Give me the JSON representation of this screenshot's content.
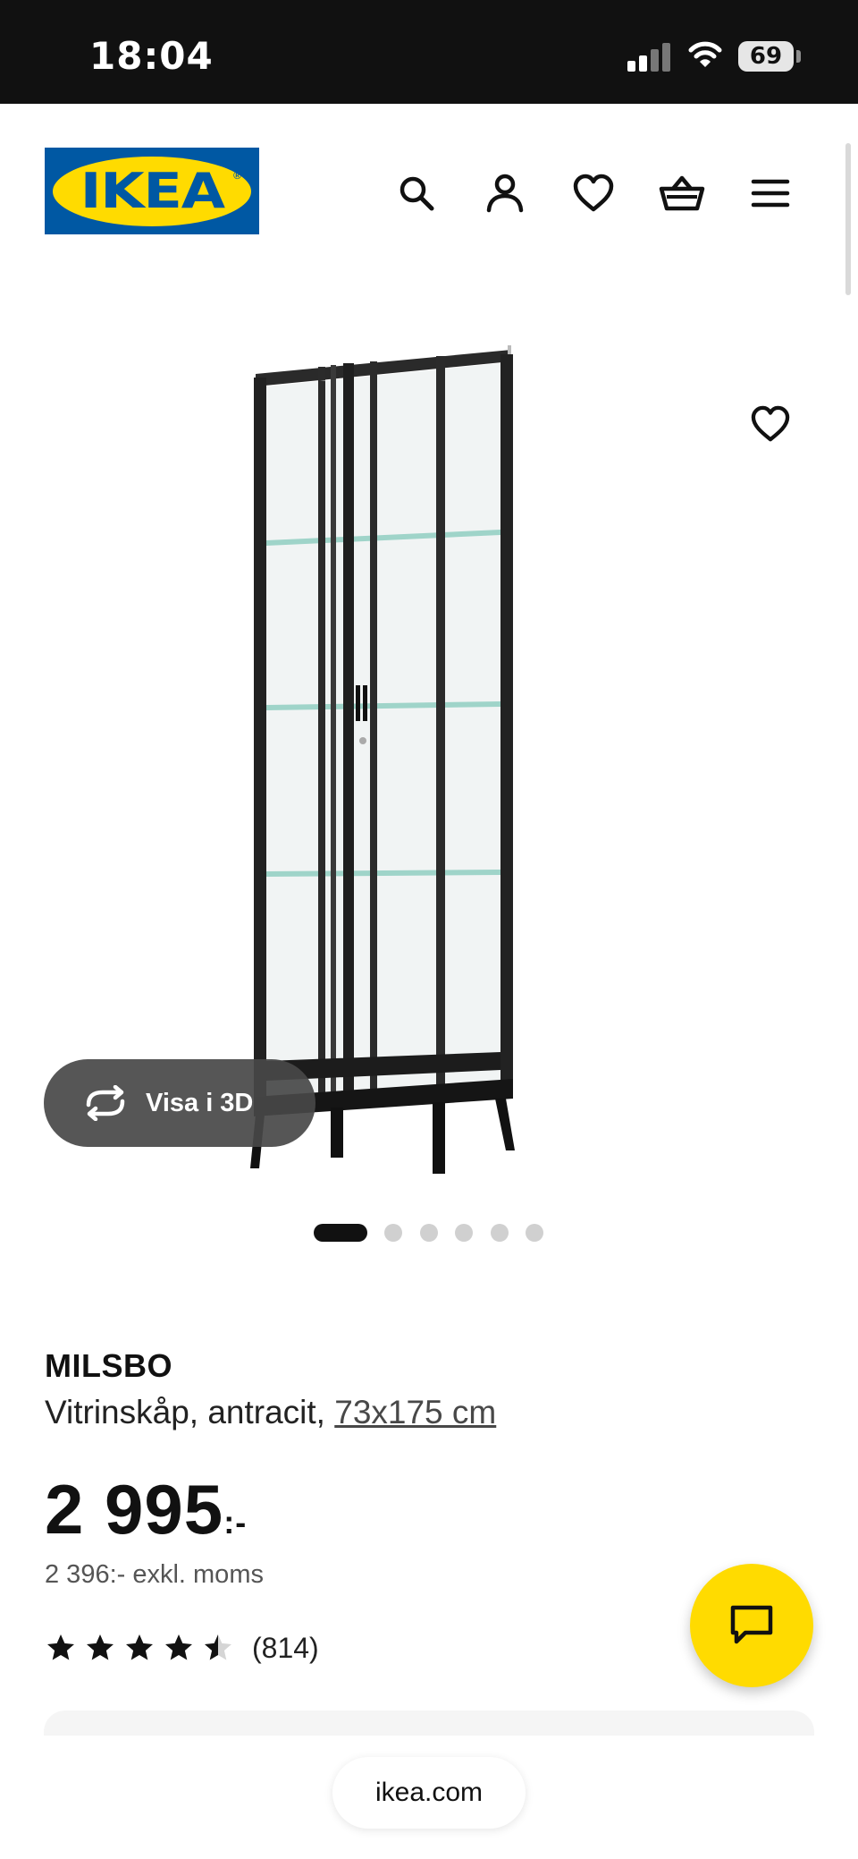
{
  "status_bar": {
    "time": "18:04",
    "battery_level": "69",
    "icons": [
      "signal-icon",
      "wifi-icon",
      "battery-icon"
    ]
  },
  "header": {
    "logo_text": "IKEA",
    "logo_registered": "®",
    "icons": [
      "search-icon",
      "account-icon",
      "favorites-icon",
      "cart-icon",
      "menu-icon"
    ],
    "brand_colors": {
      "blue": "#0058a3",
      "yellow": "#ffdb00"
    }
  },
  "gallery": {
    "image_subject": "glass-door display cabinet, anthracite",
    "view_3d_label": "Visa i 3D",
    "page_count": 6,
    "active_page": 1
  },
  "product": {
    "name": "MILSBO",
    "description": "Vitrinskåp, antracit, ",
    "size_link": "73x175 cm",
    "price_main": "2 995",
    "price_suffix": ":-",
    "price_excl_vat": "2 396:- exkl. moms",
    "rating": 4.5,
    "rating_max": 5,
    "review_count": "(814)"
  },
  "chat": {
    "icon": "chat-icon",
    "color": "#ffdb00"
  },
  "browser": {
    "url": "ikea.com"
  }
}
